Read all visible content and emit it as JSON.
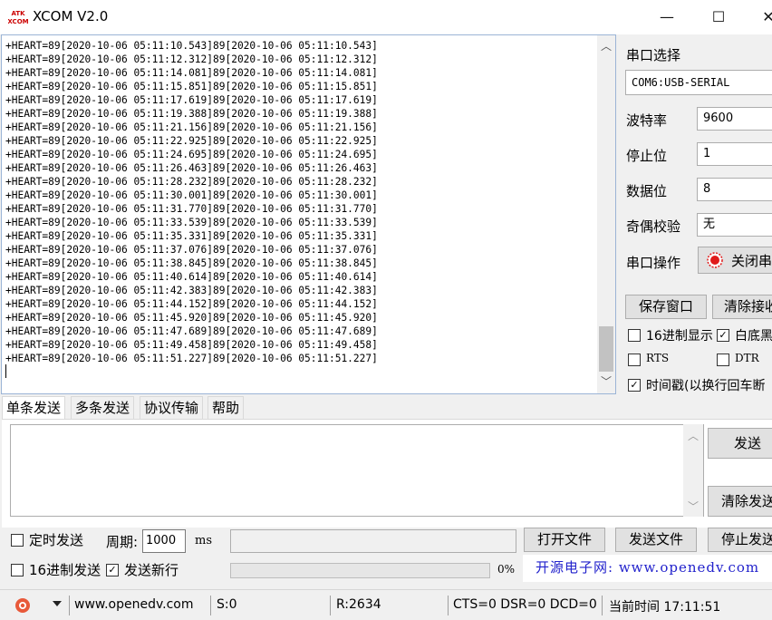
{
  "app": {
    "title": "XCOM V2.0",
    "logo_text": "ATK XCOM"
  },
  "window": {
    "minimize": "—",
    "maximize": "☐",
    "close": "✕"
  },
  "receive": {
    "lines": [
      "+HEART=89[2020-10-06 05:11:10.543]89[2020-10-06 05:11:10.543]",
      "+HEART=89[2020-10-06 05:11:12.312]89[2020-10-06 05:11:12.312]",
      "+HEART=89[2020-10-06 05:11:14.081]89[2020-10-06 05:11:14.081]",
      "+HEART=89[2020-10-06 05:11:15.851]89[2020-10-06 05:11:15.851]",
      "+HEART=89[2020-10-06 05:11:17.619]89[2020-10-06 05:11:17.619]",
      "+HEART=89[2020-10-06 05:11:19.388]89[2020-10-06 05:11:19.388]",
      "+HEART=89[2020-10-06 05:11:21.156]89[2020-10-06 05:11:21.156]",
      "+HEART=89[2020-10-06 05:11:22.925]89[2020-10-06 05:11:22.925]",
      "+HEART=89[2020-10-06 05:11:24.695]89[2020-10-06 05:11:24.695]",
      "+HEART=89[2020-10-06 05:11:26.463]89[2020-10-06 05:11:26.463]",
      "+HEART=89[2020-10-06 05:11:28.232]89[2020-10-06 05:11:28.232]",
      "+HEART=89[2020-10-06 05:11:30.001]89[2020-10-06 05:11:30.001]",
      "+HEART=89[2020-10-06 05:11:31.770]89[2020-10-06 05:11:31.770]",
      "+HEART=89[2020-10-06 05:11:33.539]89[2020-10-06 05:11:33.539]",
      "+HEART=89[2020-10-06 05:11:35.331]89[2020-10-06 05:11:35.331]",
      "+HEART=89[2020-10-06 05:11:37.076]89[2020-10-06 05:11:37.076]",
      "+HEART=89[2020-10-06 05:11:38.845]89[2020-10-06 05:11:38.845]",
      "+HEART=89[2020-10-06 05:11:40.614]89[2020-10-06 05:11:40.614]",
      "+HEART=89[2020-10-06 05:11:42.383]89[2020-10-06 05:11:42.383]",
      "+HEART=89[2020-10-06 05:11:44.152]89[2020-10-06 05:11:44.152]",
      "+HEART=89[2020-10-06 05:11:45.920]89[2020-10-06 05:11:45.920]",
      "+HEART=89[2020-10-06 05:11:47.689]89[2020-10-06 05:11:47.689]",
      "+HEART=89[2020-10-06 05:11:49.458]89[2020-10-06 05:11:49.458]",
      "+HEART=89[2020-10-06 05:11:51.227]89[2020-10-06 05:11:51.227]"
    ]
  },
  "settings": {
    "port_label": "串口选择",
    "port_value": "COM6:USB-SERIAL",
    "baud_label": "波特率",
    "baud_value": "9600",
    "stop_label": "停止位",
    "stop_value": "1",
    "data_label": "数据位",
    "data_value": "8",
    "parity_label": "奇偶校验",
    "parity_value": "无",
    "op_label": "串口操作",
    "op_button": "关闭串",
    "save_window": "保存窗口",
    "clear_receive": "清除接收",
    "hex_display": "16进制显示",
    "white_black": "白底黑",
    "rts": "RTS",
    "dtr": "DTR",
    "timestamp": "时间戳(以换行回车断"
  },
  "tabs": [
    "单条发送",
    "多条发送",
    "协议传输",
    "帮助"
  ],
  "send": {
    "send_button": "发送",
    "clear_send": "清除发送",
    "timed_send": "定时发送",
    "period_label": "周期:",
    "period_value": "1000",
    "ms": "ms",
    "open_file": "打开文件",
    "send_file": "发送文件",
    "stop_send": "停止发送",
    "hex_send": "16进制发送",
    "send_newline": "发送新行",
    "progress_text": "0%",
    "progress": 0,
    "promo": "开源电子网: www.openedv.com"
  },
  "status": {
    "website": "www.openedv.com",
    "sent": "S:0",
    "received": "R:2634",
    "lines": "CTS=0 DSR=0 DCD=0",
    "time": "当前时间 17:11:51"
  },
  "colors": {
    "accent": "#0078d7",
    "led": "#e01b1b",
    "promo": "#2222cc"
  }
}
